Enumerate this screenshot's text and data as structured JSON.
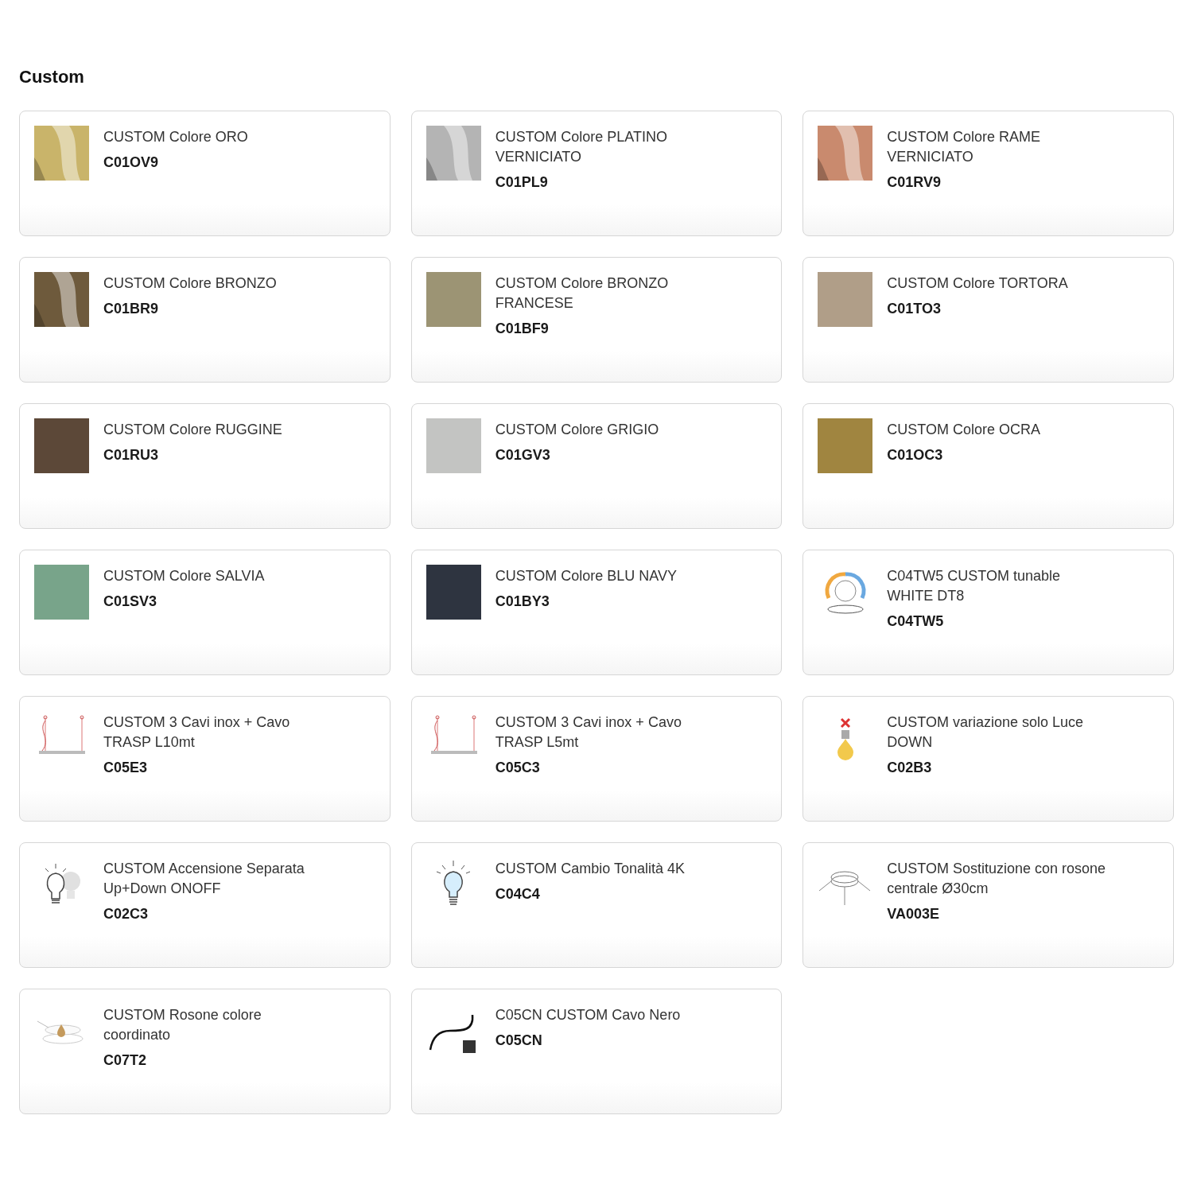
{
  "section_title": "Custom",
  "items": [
    {
      "kind": "metal",
      "color": "#c9b46a",
      "name": "CUSTOM Colore ORO",
      "code": "C01OV9"
    },
    {
      "kind": "metal",
      "color": "#b4b4b4",
      "name": "CUSTOM Colore PLATINO VERNICIATO",
      "code": "C01PL9"
    },
    {
      "kind": "metal",
      "color": "#c98a6e",
      "name": "CUSTOM Colore RAME VERNICIATO",
      "code": "C01RV9"
    },
    {
      "kind": "metal",
      "color": "#6e5a3c",
      "name": "CUSTOM Colore BRONZO",
      "code": "C01BR9"
    },
    {
      "kind": "swatch",
      "color": "#9c9474",
      "name": "CUSTOM Colore BRONZO FRANCESE",
      "code": "C01BF9"
    },
    {
      "kind": "swatch",
      "color": "#b09e88",
      "name": "CUSTOM Colore TORTORA",
      "code": "C01TO3"
    },
    {
      "kind": "swatch",
      "color": "#5c4838",
      "name": "CUSTOM Colore RUGGINE",
      "code": "C01RU3"
    },
    {
      "kind": "swatch",
      "color": "#c3c4c2",
      "name": "CUSTOM Colore GRIGIO",
      "code": "C01GV3"
    },
    {
      "kind": "swatch",
      "color": "#a08540",
      "name": "CUSTOM Colore OCRA",
      "code": "C01OC3"
    },
    {
      "kind": "swatch",
      "color": "#78a48a",
      "name": "CUSTOM Colore SALVIA",
      "code": "C01SV3"
    },
    {
      "kind": "swatch",
      "color": "#2e3440",
      "name": "CUSTOM Colore BLU NAVY",
      "code": "C01BY3"
    },
    {
      "kind": "tunable",
      "name": "C04TW5 CUSTOM tunable WHITE DT8",
      "code": "C04TW5"
    },
    {
      "kind": "cable",
      "name": "CUSTOM 3 Cavi inox + Cavo TRASP L10mt",
      "code": "C05E3"
    },
    {
      "kind": "cable",
      "name": "CUSTOM 3 Cavi inox + Cavo TRASP L5mt",
      "code": "C05C3"
    },
    {
      "kind": "down-light",
      "name": "CUSTOM variazione solo Luce DOWN",
      "code": "C02B3"
    },
    {
      "kind": "dual-bulb",
      "name": "CUSTOM Accensione Separata Up+Down ONOFF",
      "code": "C02C3"
    },
    {
      "kind": "bulb",
      "name": "CUSTOM Cambio Tonalità 4K",
      "code": "C04C4"
    },
    {
      "kind": "rosette",
      "name": "CUSTOM Sostituzione con rosone centrale Ø30cm",
      "code": "VA003E"
    },
    {
      "kind": "rosette-drop",
      "name": "CUSTOM Rosone colore coordinato",
      "code": "C07T2"
    },
    {
      "kind": "black-cable",
      "name": "C05CN CUSTOM Cavo Nero",
      "code": "C05CN"
    }
  ]
}
